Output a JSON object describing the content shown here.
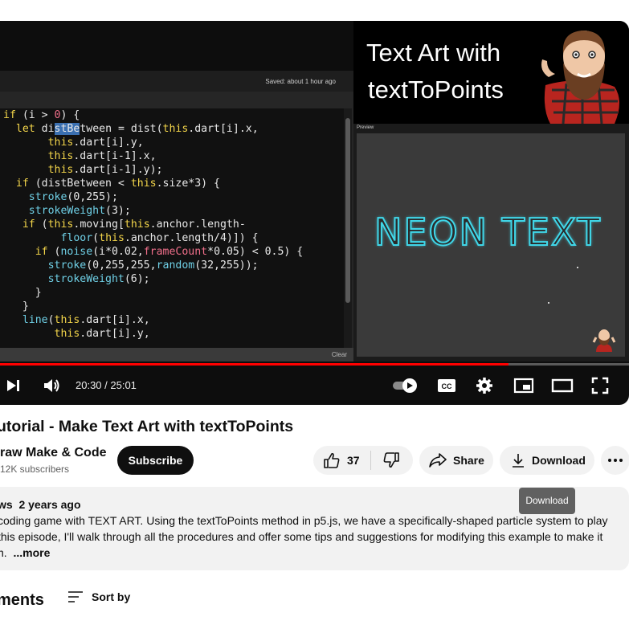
{
  "player": {
    "editor": {
      "saved_label": "Saved: about 1 hour ago",
      "console_clear": "Clear",
      "code_lines": [
        "if (i > 0) {",
        "  let distBetween = dist(this.dart[i].x,",
        "       this.dart[i].y,",
        "       this.dart[i-1].x,",
        "       this.dart[i-1].y);",
        "  if (distBetween < this.size*3) {",
        "    stroke(0,255);",
        "    strokeWeight(3);",
        "   if (this.moving[this.anchor.length-",
        "         floor(this.anchor.length/4)]) {",
        "     if (noise(i*0.02,frameCount*0.05) < 0.5) {",
        "       stroke(0,255,255,random(32,255));",
        "       strokeWeight(6);",
        "     }",
        "   }",
        "   line(this.dart[i].x,",
        "        this.dart[i].y,"
      ]
    },
    "title_card": {
      "line1": "Text Art with",
      "line2": "textToPoints"
    },
    "preview": {
      "label": "Preview",
      "canvas_text": "NEON TEXT"
    },
    "progress": {
      "played_fraction": 0.809,
      "loaded_fraction": 0.8
    },
    "time": "20:30 / 25:01",
    "icons": [
      "next-icon",
      "volume-icon",
      "autoplay-toggle-icon",
      "captions-icon",
      "settings-icon",
      "miniplayer-icon",
      "theater-icon",
      "fullscreen-icon"
    ],
    "colors": {
      "progress": "#ff0000",
      "code_keyword": "#f3d54a",
      "code_function": "#6fd0e6",
      "code_number": "#f06f8a",
      "neon": "#40d6e8"
    }
  },
  "video": {
    "title": "utorial - Make Text Art with textToPoints"
  },
  "channel": {
    "name": "raw Make & Code",
    "subscribers": "12K subscribers",
    "subscribe_label": "Subscribe"
  },
  "actions": {
    "like_count": "37",
    "share_label": "Share",
    "download_label": "Download",
    "tooltip": "Download"
  },
  "description": {
    "views": "ws",
    "age": "2 years ago",
    "line1": "coding game with TEXT ART.  Using the textToPoints method in p5.js, we have a specifically-shaped particle system to play",
    "line2": "this episode, I'll walk through all the procedures and offer some tips and suggestions for modifying this example to make it",
    "line3_start": "n.",
    "more": "...more"
  },
  "comments": {
    "title": "ments",
    "sort_label": "Sort by"
  }
}
